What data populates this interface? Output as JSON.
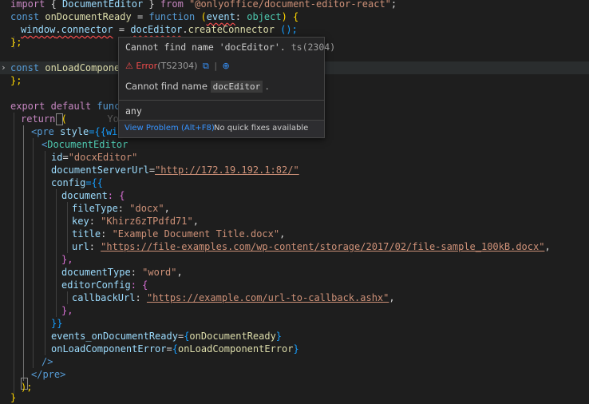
{
  "code": {
    "l1": {
      "kw": "import",
      "p1": " { ",
      "name": "DocumentEditor",
      "p2": " } ",
      "from": "from",
      "str": "\"@onlyoffice/document-editor-react\"",
      "end": ";"
    },
    "l2": {
      "kw": "const",
      "name": "onDocumentReady",
      "eq": " = ",
      "fn": "function",
      "p1": " (",
      "param": "event",
      "colon": ": ",
      "type": "object",
      "p2": ") {"
    },
    "l3": {
      "obj": "window",
      "dot": ".",
      "prop": "connector",
      "eq": " = ",
      "id": "docEditor",
      "dot2": ".",
      "call": "createConnector",
      "args": " ();"
    },
    "l4": {
      "text": "};"
    },
    "l5": {
      "kw": "const",
      "name": "onLoadComponent"
    },
    "l6": {
      "text": "};"
    },
    "l7": {
      "kw": "export",
      "kw2": "default",
      "fn": "functi"
    },
    "l8": {
      "kw": "return",
      "p": " (",
      "ghost": "You,"
    },
    "l9": {
      "tag": "pre",
      "attr": "style",
      "rest": "={{widt"
    },
    "l10": {
      "comp": "DocumentEditor"
    },
    "l11": {
      "attr": "id",
      "str": "\"docxEditor\""
    },
    "l12": {
      "attr": "documentServerUrl",
      "str": "\"http://172.19.192.1:82/\""
    },
    "l13": {
      "attr": "config",
      "rest": "={{"
    },
    "l14": {
      "key": "document",
      "rest": ": {"
    },
    "l15": {
      "key": "fileType",
      "str": "\"docx\"",
      "end": ","
    },
    "l16": {
      "key": "key",
      "str": "\"Khirz6zTPdfd71\"",
      "end": ","
    },
    "l17": {
      "key": "title",
      "str": "\"Example Document Title.docx\"",
      "end": ","
    },
    "l18": {
      "key": "url",
      "str": "\"https://file-examples.com/wp-content/storage/2017/02/file-sample_100kB.docx\"",
      "end": ","
    },
    "l19": {
      "text": "},"
    },
    "l20": {
      "key": "documentType",
      "str": "\"word\"",
      "end": ","
    },
    "l21": {
      "key": "editorConfig",
      "rest": ": {"
    },
    "l22": {
      "key": "callbackUrl",
      "str": "\"https://example.com/url-to-callback.ashx\"",
      "end": ","
    },
    "l23": {
      "text": "},"
    },
    "l24": {
      "text": "}}"
    },
    "l25": {
      "attr": "events_onDocumentReady",
      "val": "onDocumentReady"
    },
    "l26": {
      "attr": "onLoadComponentError",
      "val": "onLoadComponentError"
    },
    "l27": {
      "text": "/>"
    },
    "l28": {
      "tag": "pre"
    },
    "l29": {
      "text": ");"
    },
    "l30": {
      "text": "}"
    }
  },
  "hover": {
    "signature": "Cannot find name 'docEditor'.",
    "signature_code": "ts(2304)",
    "error_icon": "warning-triangle-icon",
    "error_label": "Error",
    "error_code": "(TS2304)",
    "message_prefix": "Cannot find name ",
    "message_ident": "docEditor",
    "message_suffix": " .",
    "type_value": "any",
    "view_problem": "View Problem (Alt+F8)",
    "no_fixes": "No quick fixes available"
  },
  "colors": {
    "background": "#1e1e1e",
    "keyword": "#c586c0",
    "string": "#ce9178",
    "error": "#f14c4c",
    "link": "#3794ff"
  }
}
